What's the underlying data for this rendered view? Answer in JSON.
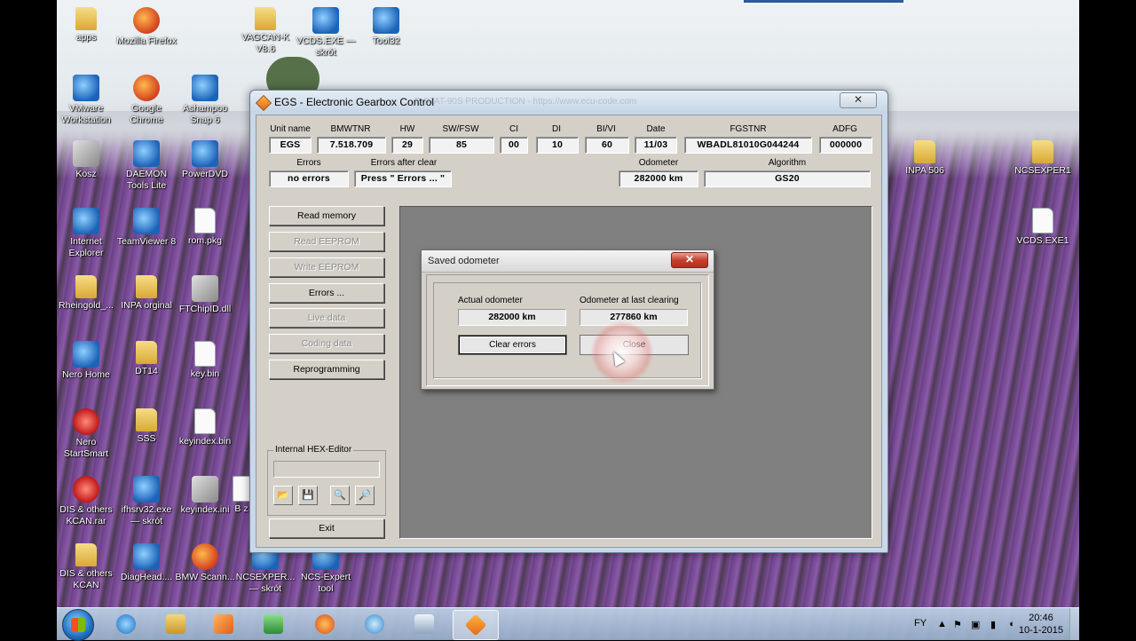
{
  "desktop": {
    "icons": [
      {
        "label": "apps",
        "type": "folder"
      },
      {
        "label": "Mozilla Firefox",
        "type": "app"
      },
      {
        "label": "VAGCAN-K V8.6",
        "type": "folder"
      },
      {
        "label": "VCDS.EXE — skrót",
        "type": "blue"
      },
      {
        "label": "Tool32",
        "type": "blue"
      },
      {
        "label": "VMware Workstation",
        "type": "blue"
      },
      {
        "label": "Google Chrome",
        "type": "app"
      },
      {
        "label": "Ashampoo Snap 6",
        "type": "blue"
      },
      {
        "label": "Kosz",
        "type": "gray"
      },
      {
        "label": "DAEMON Tools Lite",
        "type": "blue"
      },
      {
        "label": "PowerDVD",
        "type": "blue"
      },
      {
        "label": "Internet Explorer",
        "type": "blue"
      },
      {
        "label": "TeamViewer 8",
        "type": "blue"
      },
      {
        "label": "rom.pkg",
        "type": "file"
      },
      {
        "label": "Rheingold_...",
        "type": "folder"
      },
      {
        "label": "INPA orginal",
        "type": "folder"
      },
      {
        "label": "FTChipID.dll",
        "type": "gray"
      },
      {
        "label": "Nero Home",
        "type": "blue"
      },
      {
        "label": "DT14",
        "type": "folder"
      },
      {
        "label": "key.bin",
        "type": "file"
      },
      {
        "label": "Nero StartSmart",
        "type": "red"
      },
      {
        "label": "SSS",
        "type": "folder"
      },
      {
        "label": "keyindex.bin",
        "type": "file"
      },
      {
        "label": "DIS & others KCAN.rar",
        "type": "red"
      },
      {
        "label": "ifhsrv32.exe — skrót",
        "type": "blue"
      },
      {
        "label": "keyindex.ini",
        "type": "gray"
      },
      {
        "label": "DIS & others KCAN",
        "type": "folder"
      },
      {
        "label": "DiagHead....",
        "type": "blue"
      },
      {
        "label": "BMW Scann...",
        "type": "app"
      },
      {
        "label": "NCSEXPER... — skrót",
        "type": "blue"
      },
      {
        "label": "NCS-Expert tool",
        "type": "blue"
      },
      {
        "label": "INPA 506",
        "type": "folder"
      },
      {
        "label": "NCSEXPER1",
        "type": "folder"
      },
      {
        "label": "VCDS.EXE1",
        "type": "file"
      },
      {
        "label": "B z",
        "type": "file"
      }
    ]
  },
  "egs": {
    "title": "EGS - Electronic Gearbox Control",
    "faded_title": "P-STAT-90S   PRODUCTION  -  https://www.ecu-code.com",
    "close": "✕",
    "headers": {
      "unit_name": "Unit name",
      "bmwtnr": "BMWTNR",
      "hw": "HW",
      "sw_fsw": "SW/FSW",
      "ci": "CI",
      "di": "DI",
      "bi_vi": "BI/VI",
      "date": "Date",
      "fgstnr": "FGSTNR",
      "adfg": "ADFG"
    },
    "values": {
      "unit_name": "EGS",
      "bmwtnr": "7.518.709",
      "hw": "29",
      "sw_fsw": "85",
      "ci": "00",
      "di": "10",
      "bi_vi": "60",
      "date": "11/03",
      "fgstnr": "WBADL81010G044244",
      "adfg": "000000"
    },
    "status": {
      "errors_label": "Errors",
      "errors_value": "no errors",
      "errors_after_clear_label": "Errors after clear",
      "errors_after_clear_value": "Press \" Errors ... \"",
      "odometer_label": "Odometer",
      "odometer_value": "282000 km",
      "algorithm_label": "Algorithm",
      "algorithm_value": "GS20"
    },
    "buttons": {
      "read_memory": "Read memory",
      "read_eeprom": "Read EEPROM",
      "write_eeprom": "Write EEPROM",
      "errors": "Errors ...",
      "live_data": "Live data",
      "coding_data": "Coding data",
      "reprogramming": "Reprogramming",
      "exit": "Exit"
    },
    "hex_editor": {
      "title": "Internal HEX-Editor",
      "tools": [
        "📂",
        "💾",
        "🔍",
        "🔎"
      ]
    }
  },
  "dialog": {
    "title": "Saved odometer",
    "close": "✕",
    "actual_label": "Actual odometer",
    "actual_value": "282000 km",
    "last_label": "Odometer at last clearing",
    "last_value": "277860 km",
    "clear_button": "Clear errors",
    "close_button": "Close"
  },
  "taskbar": {
    "items": [
      "internet-explorer",
      "explorer",
      "media-player",
      "task-manager",
      "firefox",
      "network",
      "keyboard",
      "egs"
    ],
    "lang": "FY",
    "time": "20:46",
    "date": "10-1-2015"
  }
}
